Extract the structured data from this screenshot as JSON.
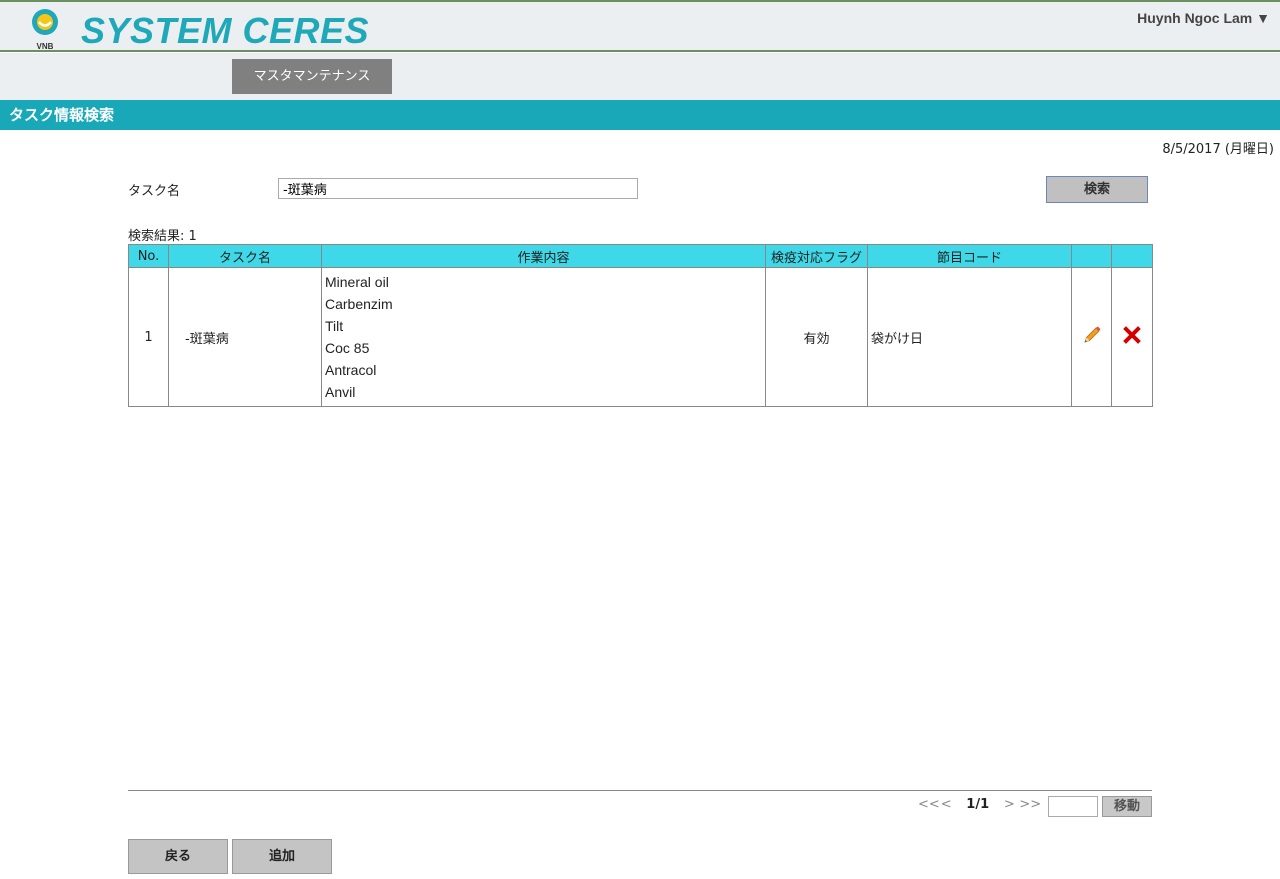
{
  "app": {
    "title": "SYSTEM CERES",
    "logo_text": "VNB",
    "user_name": "Huynh Ngoc Lam ▼"
  },
  "nav": {
    "master_maintenance_label": "マスタマンテナンス"
  },
  "page": {
    "title": "タスク情報検索",
    "date": "8/5/2017 (月曜日)"
  },
  "search": {
    "task_name_label": "タスク名",
    "task_name_value": "-斑葉病",
    "search_button": "検索"
  },
  "results": {
    "count_label": "検索結果: 1",
    "columns": [
      "No.",
      "タスク名",
      "作業内容",
      "検疫対応フラグ",
      "節目コード",
      "",
      ""
    ],
    "rows": [
      {
        "no": "1",
        "task_name": "-斑葉病",
        "work_content": [
          "Mineral oil",
          "Carbenzim",
          "Tilt",
          "Coc 85",
          "Antracol",
          "Anvil"
        ],
        "quarantine_flag": "有効",
        "milestone_code": "袋がけ日",
        "edit_icon": "pencil-icon",
        "delete_icon": "delete-x-icon"
      }
    ]
  },
  "pagination": {
    "first": "<<",
    "prev": "<",
    "current": "1/1",
    "next": ">",
    "last": ">>",
    "go_button": "移動"
  },
  "footer": {
    "back_button": "戻る",
    "add_button": "追加"
  },
  "colors": {
    "header_bg": "#eceff1",
    "accent": "#19a8b8",
    "table_header": "#3ed8e8",
    "delete": "#d40000",
    "edit": "#f0a020"
  }
}
